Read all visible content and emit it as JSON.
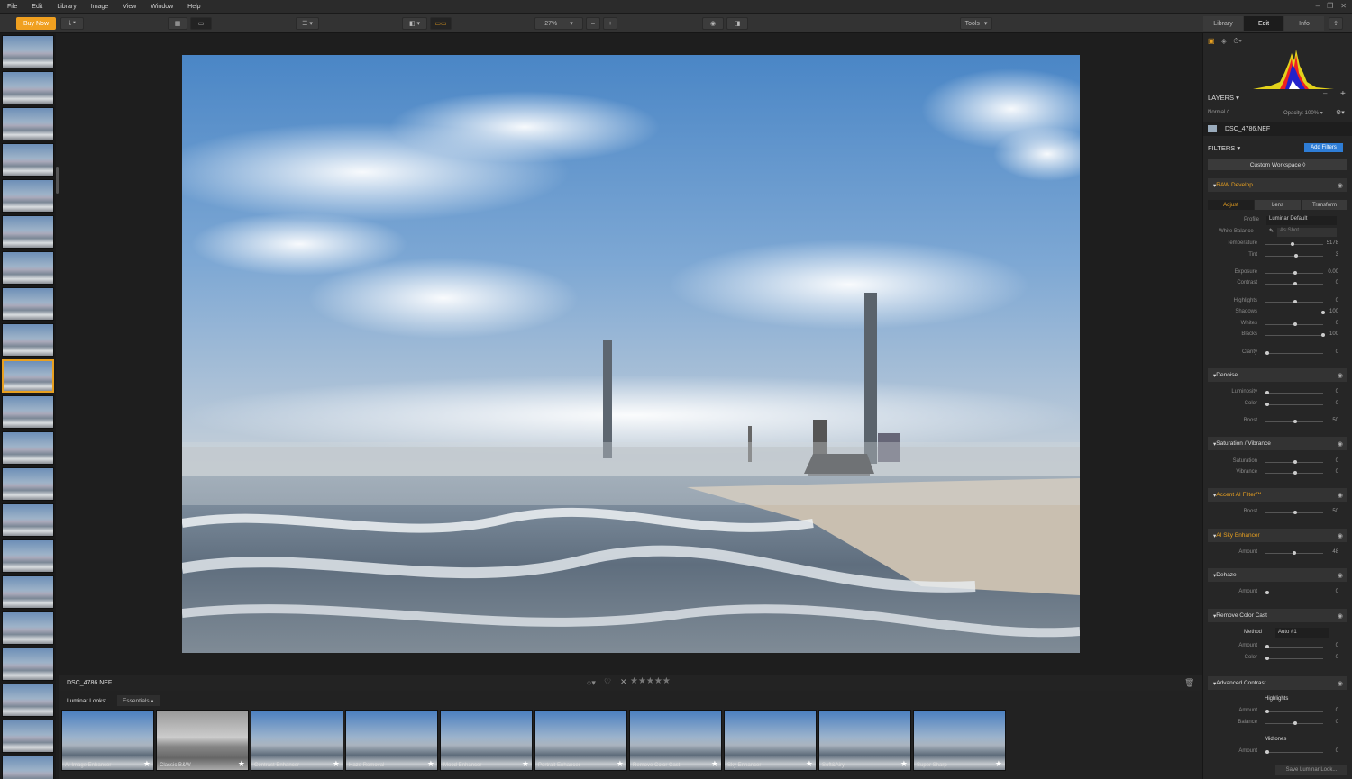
{
  "menu": [
    "File",
    "Edit",
    "Library",
    "Image",
    "View",
    "Window",
    "Help"
  ],
  "toolbar": {
    "buy_now": "Buy Now",
    "zoom": "27%",
    "tools": "Tools",
    "zoom_minus": "–",
    "zoom_plus": "+"
  },
  "modes": {
    "library": "Library",
    "edit": "Edit",
    "info": "Info"
  },
  "filename_bottom": "DSC_4786.NEF",
  "luminar_looks": {
    "label": "Luminar Looks:",
    "category": "Essentials",
    "items": [
      "AI Image Enhancer",
      "Classic B&W",
      "Contrast Enhancer",
      "Haze Removal",
      "Mood Enhancer",
      "Portrait Enhancer",
      "Remove Color Cast",
      "Sky Enhancer",
      "Soft&Airy",
      "Super Sharp"
    ]
  },
  "panel": {
    "layers_label": "LAYERS",
    "blend": "Normal",
    "opacity": "Opacity: 100%",
    "layer_name": "DSC_4786.NEF",
    "filters_label": "FILTERS",
    "add_filters": "Add Filters",
    "workspace": "Custom Workspace",
    "raw_develop": "RAW Develop",
    "tabs": [
      "Adjust",
      "Lens",
      "Transform"
    ],
    "profile_label": "Profile",
    "profile_value": "Luminar Default",
    "wb_label": "White Balance",
    "wb_value": "As Shot",
    "temperature": {
      "label": "Temperature",
      "value": "5178",
      "pos": 0.45
    },
    "tint": {
      "label": "Tint",
      "value": "3",
      "pos": 0.52
    },
    "exposure": {
      "label": "Exposure",
      "value": "0.00",
      "pos": 0.5
    },
    "contrast": {
      "label": "Contrast",
      "value": "0",
      "pos": 0.5
    },
    "highlights": {
      "label": "Highlights",
      "value": "0",
      "pos": 0.5
    },
    "shadows": {
      "label": "Shadows",
      "value": "100",
      "pos": 1.0
    },
    "whites": {
      "label": "Whites",
      "value": "0",
      "pos": 0.5
    },
    "blacks": {
      "label": "Blacks",
      "value": "100",
      "pos": 1.0
    },
    "clarity": {
      "label": "Clarity",
      "value": "0",
      "pos": 0.0
    },
    "denoise": "Denoise",
    "luminosity": {
      "label": "Luminosity",
      "value": "0",
      "pos": 0.0
    },
    "color": {
      "label": "Color",
      "value": "0",
      "pos": 0.0
    },
    "boost_dn": {
      "label": "Boost",
      "value": "50",
      "pos": 0.5
    },
    "satvib": "Saturation / Vibrance",
    "saturation": {
      "label": "Saturation",
      "value": "0",
      "pos": 0.5
    },
    "vibrance": {
      "label": "Vibrance",
      "value": "0",
      "pos": 0.5
    },
    "accent": "Accent AI Filter™",
    "boost_ac": {
      "label": "Boost",
      "value": "50",
      "pos": 0.5
    },
    "sky": "AI Sky Enhancer",
    "amount_sky": {
      "label": "Amount",
      "value": "48",
      "pos": 0.48
    },
    "dehaze": "Dehaze",
    "amount_dh": {
      "label": "Amount",
      "value": "0",
      "pos": 0.0
    },
    "rcc": "Remove Color Cast",
    "method_label": "Method",
    "method_value": "Auto #1",
    "amount_rcc": {
      "label": "Amount",
      "value": "0",
      "pos": 0.0
    },
    "color_rcc": {
      "label": "Color",
      "value": "0",
      "pos": 0.0
    },
    "adv_contrast": "Advanced Contrast",
    "highlights_h": "Highlights",
    "amount_hl": {
      "label": "Amount",
      "value": "0",
      "pos": 0.0
    },
    "balance_hl": {
      "label": "Balance",
      "value": "0",
      "pos": 0.5
    },
    "midtones_h": "Midtones",
    "amount_mt": {
      "label": "Amount",
      "value": "0",
      "pos": 0.0
    },
    "save_look": "Save Luminar Look..."
  },
  "colors": {
    "accent": "#f0a020",
    "blue_button": "#2e7dd6"
  }
}
